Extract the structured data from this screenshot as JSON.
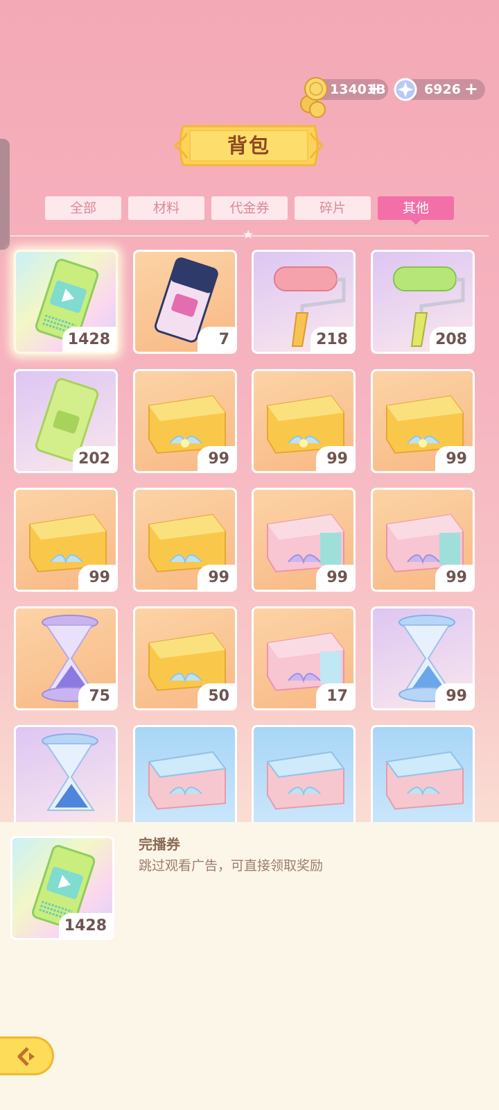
{
  "currency": {
    "coins": "13401B",
    "gems": "6926",
    "plus": "+"
  },
  "title": "背包",
  "tabs": [
    {
      "label": "全部",
      "active": false
    },
    {
      "label": "材料",
      "active": false
    },
    {
      "label": "代金券",
      "active": false
    },
    {
      "label": "碎片",
      "active": false
    },
    {
      "label": "其他",
      "active": true
    }
  ],
  "items": [
    {
      "icon": "ticket-icon",
      "count": "1428"
    },
    {
      "icon": "ticket-icon",
      "count": "7"
    },
    {
      "icon": "paint-roller-icon",
      "count": "218"
    },
    {
      "icon": "paint-roller-icon",
      "count": "208"
    },
    {
      "icon": "ticket-icon",
      "count": "202"
    },
    {
      "icon": "gift-box-icon",
      "count": "99"
    },
    {
      "icon": "gift-box-icon",
      "count": "99"
    },
    {
      "icon": "gift-box-icon",
      "count": "99"
    },
    {
      "icon": "gift-box-icon",
      "count": "99"
    },
    {
      "icon": "gift-box-icon",
      "count": "99"
    },
    {
      "icon": "gift-box-icon",
      "count": "99"
    },
    {
      "icon": "gift-box-icon",
      "count": "99"
    },
    {
      "icon": "hourglass-icon",
      "count": "75"
    },
    {
      "icon": "gift-box-icon",
      "count": "50"
    },
    {
      "icon": "gift-box-icon",
      "count": "17"
    },
    {
      "icon": "hourglass-icon",
      "count": "99"
    },
    {
      "icon": "hourglass-icon",
      "count": ""
    },
    {
      "icon": "gift-box-icon",
      "count": ""
    },
    {
      "icon": "gift-box-icon",
      "count": ""
    },
    {
      "icon": "gift-box-icon",
      "count": ""
    }
  ],
  "detail": {
    "name": "完播券",
    "description": "跳过观看广告，可直接领取奖励",
    "count": "1428"
  },
  "colors": {
    "accent": "#f36fa8",
    "title_banner": "#fcd35a",
    "count_text": "#6e5450"
  }
}
